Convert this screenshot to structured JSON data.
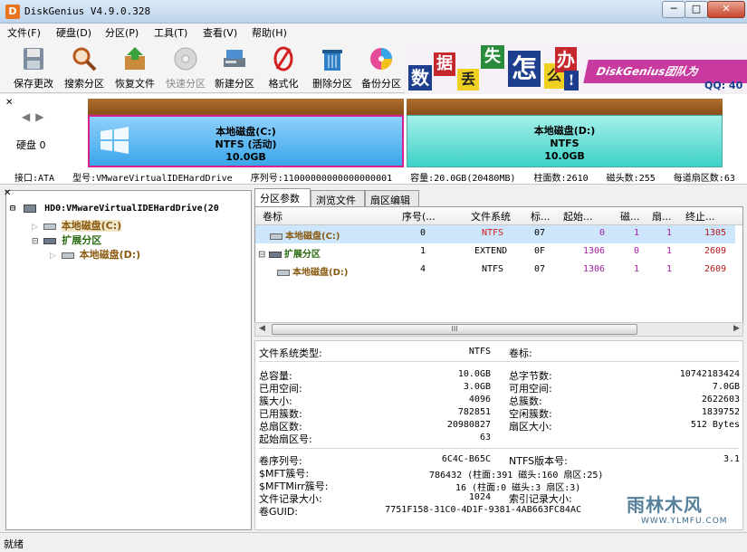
{
  "window": {
    "title": "DiskGenius V4.9.0.328",
    "app_icon": "D",
    "minimize": "─",
    "maximize": "□",
    "close": "✕"
  },
  "menu": [
    "文件(F)",
    "硬盘(D)",
    "分区(P)",
    "工具(T)",
    "查看(V)",
    "帮助(H)"
  ],
  "toolbar": [
    {
      "label": "保存更改",
      "icon": "save-disk-icon",
      "disabled": false
    },
    {
      "label": "搜索分区",
      "icon": "magnifier-icon",
      "disabled": false
    },
    {
      "label": "恢复文件",
      "icon": "recover-box-icon",
      "disabled": false
    },
    {
      "label": "快速分区",
      "icon": "quick-partition-icon",
      "disabled": true
    },
    {
      "label": "新建分区",
      "icon": "new-partition-icon",
      "disabled": false
    },
    {
      "label": "格式化",
      "icon": "format-icon",
      "disabled": false
    },
    {
      "label": "删除分区",
      "icon": "trash-icon",
      "disabled": false
    },
    {
      "label": "备份分区",
      "icon": "backup-disc-icon",
      "disabled": false
    }
  ],
  "banner": {
    "chars": [
      "数",
      "据",
      "丢",
      "失",
      "怎",
      "么",
      "办",
      "!"
    ],
    "slogan": "DiskGenius团队为",
    "qq": "QQ: 40"
  },
  "disk_map": {
    "disk_label": "硬盘 0",
    "partitions": [
      {
        "name": "本地磁盘(C:)",
        "fs": "NTFS (活动)",
        "size": "10.0GB"
      },
      {
        "name": "本地磁盘(D:)",
        "fs": "NTFS",
        "size": "10.0GB"
      }
    ],
    "info": [
      "接口:ATA",
      "型号:VMwareVirtualIDEHardDrive",
      "序列号:11000000000000000001",
      "容量:20.0GB(20480MB)",
      "柱面数:2610",
      "磁头数:255",
      "每道扇区数:63"
    ]
  },
  "tree": {
    "disk": "HD0:VMwareVirtualIDEHardDrive(20",
    "items": [
      {
        "label": "本地磁盘(C:)",
        "level": 1,
        "selected": true
      },
      {
        "label": "扩展分区",
        "level": 1,
        "selected": false
      },
      {
        "label": "本地磁盘(D:)",
        "level": 2,
        "selected": false
      }
    ]
  },
  "tabs": [
    "分区参数",
    "浏览文件",
    "扇区编辑"
  ],
  "table": {
    "headers": [
      "卷标",
      "序号(...",
      "文件系统",
      "标...",
      "起始...",
      "磁...",
      "扇...",
      "终止..."
    ],
    "rows": [
      {
        "label": "本地磁盘(C:)",
        "seq": "0",
        "fs": "NTFS",
        "id": "07",
        "start_cyl": "0",
        "head": "1",
        "sector": "1",
        "end_cyl": "1305",
        "selected": true
      },
      {
        "label": "扩展分区",
        "seq": "1",
        "fs": "EXTEND",
        "id": "0F",
        "start_cyl": "1306",
        "head": "0",
        "sector": "1",
        "end_cyl": "2609",
        "selected": false
      },
      {
        "label": "本地磁盘(D:)",
        "seq": "4",
        "fs": "NTFS",
        "id": "07",
        "start_cyl": "1306",
        "head": "1",
        "sector": "1",
        "end_cyl": "2609",
        "selected": false
      }
    ],
    "scroll_label": "III"
  },
  "details": {
    "fs_type_label": "文件系统类型:",
    "fs_type": "NTFS",
    "volume_label_label": "卷标:",
    "left": [
      {
        "k": "总容量:",
        "v": "10.0GB"
      },
      {
        "k": "已用空间:",
        "v": "3.0GB"
      },
      {
        "k": "簇大小:",
        "v": "4096"
      },
      {
        "k": "已用簇数:",
        "v": "782851"
      },
      {
        "k": "总扇区数:",
        "v": "20980827"
      },
      {
        "k": "起始扇区号:",
        "v": "63"
      }
    ],
    "right": [
      {
        "k": "总字节数:",
        "v": "10742183424"
      },
      {
        "k": "可用空间:",
        "v": "7.0GB"
      },
      {
        "k": "总簇数:",
        "v": "2622603"
      },
      {
        "k": "空闲簇数:",
        "v": "1839752"
      },
      {
        "k": "扇区大小:",
        "v": "512 Bytes"
      }
    ],
    "serial_label": "卷序列号:",
    "serial": "6C4C-B65C",
    "ntfs_ver_label": "NTFS版本号:",
    "ntfs_ver": "3.1",
    "mft_label": "$MFT簇号:",
    "mft": "786432 (柱面:391 磁头:160 扇区:25)",
    "mftmirr_label": "$MFTMirr簇号:",
    "mftmirr": "16 (柱面:0 磁头:3 扇区:3)",
    "record_size_label": "文件记录大小:",
    "record_size": "1024",
    "index_size_label": "索引记录大小:",
    "guid_label": "卷GUID:",
    "guid": "7751F158-31C0-4D1F-9381-4AB663FC84AC"
  },
  "status": "就绪",
  "watermark": {
    "line1": "雨林木风",
    "line2": "WWW.YLMFU.COM"
  }
}
